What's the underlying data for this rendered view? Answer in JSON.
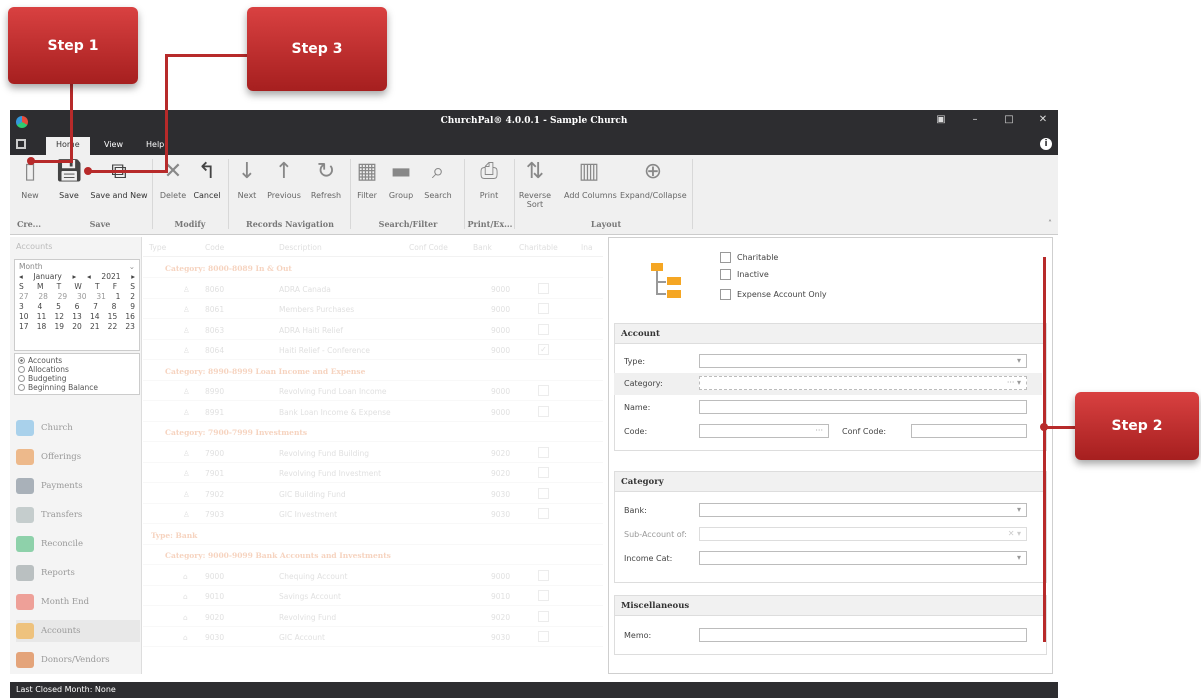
{
  "callouts": {
    "step1": "Step 1",
    "step2": "Step 2",
    "step3": "Step 3"
  },
  "window": {
    "title": "ChurchPal® 4.0.0.1 - Sample Church"
  },
  "tabs": [
    "Home",
    "View",
    "Help"
  ],
  "ribbon": {
    "new": "New",
    "save": "Save",
    "save_and_new": "Save and New",
    "delete": "Delete",
    "cancel": "Cancel",
    "next": "Next",
    "previous": "Previous",
    "refresh": "Refresh",
    "filter": "Filter",
    "group": "Group",
    "search": "Search",
    "print": "Print",
    "reverse_sort": "Reverse Sort",
    "add_columns": "Add Columns",
    "expand_collapse": "Expand/Collapse",
    "groups": {
      "create": "Cre...",
      "save": "Save",
      "modify": "Modify",
      "records_nav": "Records Navigation",
      "search_filter": "Search/Filter",
      "print_export": "Print/Ex...",
      "layout": "Layout"
    }
  },
  "leftnav": {
    "title": "Accounts",
    "calendar": {
      "view": "Month",
      "month": "January",
      "year": "2021",
      "days": [
        "S",
        "M",
        "T",
        "W",
        "T",
        "F",
        "S"
      ],
      "weeks": [
        [
          "27",
          "28",
          "29",
          "30",
          "31",
          "1",
          "2"
        ],
        [
          "3",
          "4",
          "5",
          "6",
          "7",
          "8",
          "9"
        ],
        [
          "10",
          "11",
          "12",
          "13",
          "14",
          "15",
          "16"
        ],
        [
          "17",
          "18",
          "19",
          "20",
          "21",
          "22",
          "23"
        ]
      ]
    },
    "radios": [
      "Accounts",
      "Allocations",
      "Budgeting",
      "Beginning Balance"
    ],
    "items": [
      "Church",
      "Offerings",
      "Payments",
      "Transfers",
      "Reconcile",
      "Reports",
      "Month End",
      "Accounts",
      "Donors/Vendors"
    ]
  },
  "grid": {
    "headers": [
      "Type",
      "Code",
      "Description",
      "Conf Code",
      "Bank",
      "Charitable",
      "Ina"
    ],
    "rows": [
      {
        "group": "Category: 8000-8089 In & Out"
      },
      {
        "code": "8060",
        "desc": "ADRA Canada",
        "bank": "9000"
      },
      {
        "code": "8061",
        "desc": "Members Purchases",
        "bank": "9000"
      },
      {
        "code": "8063",
        "desc": "ADRA Haiti Relief",
        "bank": "9000"
      },
      {
        "code": "8064",
        "desc": "Haiti Relief - Conference",
        "bank": "9000"
      },
      {
        "group": "Category: 8990-8999 Loan Income and Expense"
      },
      {
        "code": "8990",
        "desc": "Revolving Fund Loan Income",
        "bank": "9000"
      },
      {
        "code": "8991",
        "desc": "Bank Loan Income & Expense",
        "bank": "9000"
      },
      {
        "group": "Category: 7900-7999 Investments"
      },
      {
        "code": "7900",
        "desc": "Revolving Fund Building",
        "bank": "9020"
      },
      {
        "code": "7901",
        "desc": "Revolving Fund Investment",
        "bank": "9020"
      },
      {
        "code": "7902",
        "desc": "GIC Building Fund",
        "bank": "9030"
      },
      {
        "code": "7903",
        "desc": "GIC Investment",
        "bank": "9030"
      },
      {
        "group": "Type: Bank"
      },
      {
        "group": "Category: 9000-9099 Bank Accounts and Investments"
      },
      {
        "code": "9000",
        "desc": "Chequing Account",
        "bank": "9000"
      },
      {
        "code": "9010",
        "desc": "Savings Account",
        "bank": "9010"
      },
      {
        "code": "9020",
        "desc": "Revolving Fund",
        "bank": "9020"
      },
      {
        "code": "9030",
        "desc": "GIC Account",
        "bank": "9030"
      }
    ]
  },
  "form": {
    "charitable": "Charitable",
    "inactive": "Inactive",
    "expense_only": "Expense Account Only",
    "account_section": "Account",
    "type": "Type:",
    "category": "Category:",
    "name": "Name:",
    "code": "Code:",
    "conf_code": "Conf Code:",
    "category_section": "Category",
    "bank": "Bank:",
    "sub_account": "Sub-Account of:",
    "income_cat": "Income Cat:",
    "misc_section": "Miscellaneous",
    "memo": "Memo:"
  },
  "status": {
    "text": "Last Closed Month: None"
  }
}
